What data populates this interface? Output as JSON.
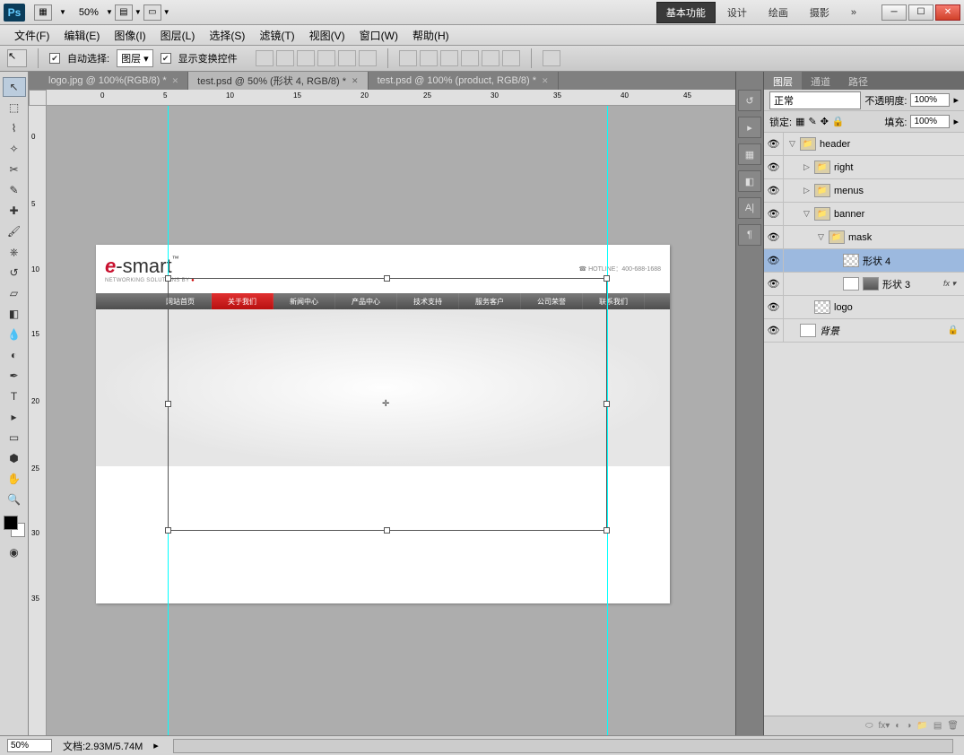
{
  "titlebar": {
    "ps": "Ps",
    "zoom": "50%",
    "workspaces": [
      "基本功能",
      "设计",
      "绘画",
      "摄影"
    ],
    "arrows": "»"
  },
  "menubar": [
    "文件(F)",
    "编辑(E)",
    "图像(I)",
    "图层(L)",
    "选择(S)",
    "滤镜(T)",
    "视图(V)",
    "窗口(W)",
    "帮助(H)"
  ],
  "options": {
    "auto_select": "自动选择:",
    "target": "图层",
    "show_transform": "显示变换控件"
  },
  "tabs": [
    {
      "label": "logo.jpg @ 100%(RGB/8) *",
      "active": false
    },
    {
      "label": "test.psd @ 50% (形状 4, RGB/8) *",
      "active": true
    },
    {
      "label": "test.psd @ 100% (product, RGB/8) *",
      "active": false
    }
  ],
  "ruler_h": [
    "0",
    "5",
    "10",
    "15",
    "20",
    "25",
    "30",
    "35",
    "40",
    "45"
  ],
  "ruler_v": [
    "0",
    "5",
    "10",
    "15",
    "20",
    "25",
    "30",
    "35"
  ],
  "doc": {
    "logo_main": "e-smart",
    "logo_prefix": "e",
    "logo_suffix": "-smart",
    "logo_tm": "™",
    "logo_sub": "NETWORKING SOLUTIONS BY ",
    "hotline": "HOTLINE：400-688-1688",
    "nav": [
      "网站首页",
      "关于我们",
      "新闻中心",
      "产品中心",
      "技术支持",
      "服务客户",
      "公司荣誉",
      "联系我们"
    ]
  },
  "panels": {
    "tabs": [
      "图层",
      "通道",
      "路径"
    ],
    "blend": "正常",
    "opacity_label": "不透明度:",
    "opacity": "100%",
    "lock_label": "锁定:",
    "fill_label": "填充:",
    "fill": "100%",
    "layers": [
      {
        "type": "group",
        "name": "header",
        "depth": 0,
        "open": true
      },
      {
        "type": "group",
        "name": "right",
        "depth": 1,
        "open": false
      },
      {
        "type": "group",
        "name": "menus",
        "depth": 1,
        "open": false
      },
      {
        "type": "group",
        "name": "banner",
        "depth": 1,
        "open": true
      },
      {
        "type": "group",
        "name": "mask",
        "depth": 2,
        "open": true,
        "thumb": "grey"
      },
      {
        "type": "layer",
        "name": "形状 4",
        "depth": 3,
        "selected": true,
        "thumb": "checker"
      },
      {
        "type": "layer",
        "name": "形状 3",
        "depth": 3,
        "thumb": "grey",
        "mask": true,
        "fx": true
      },
      {
        "type": "layer",
        "name": "logo",
        "depth": 1,
        "thumb": "checker"
      },
      {
        "type": "layer",
        "name": "背景",
        "depth": 0,
        "thumb": "white",
        "locked": true,
        "italic": true
      }
    ]
  },
  "status": {
    "zoom": "50%",
    "doc": "文档:2.93M/5.74M"
  }
}
